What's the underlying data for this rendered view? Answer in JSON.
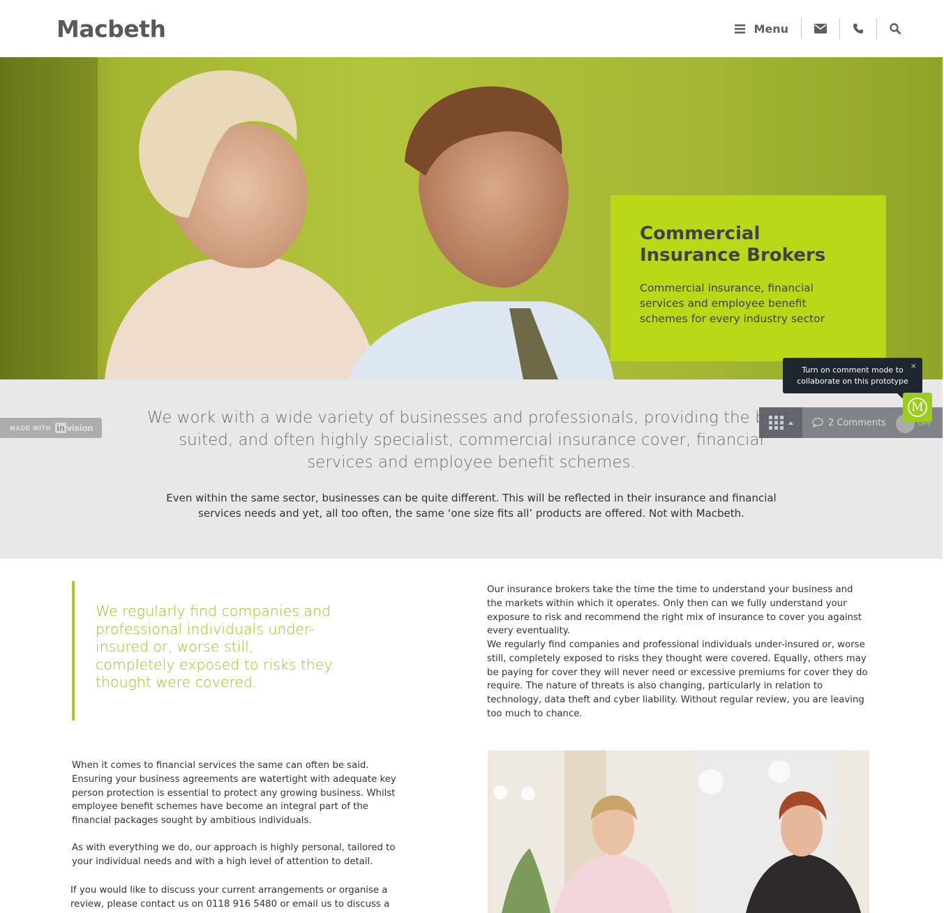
{
  "header": {
    "logo": "Macbeth",
    "menu_label": "Menu",
    "icons": [
      "bars-icon",
      "envelope-icon",
      "phone-icon",
      "search-icon"
    ]
  },
  "hero": {
    "title": "Commercial Insurance Brokers",
    "subtitle": "Commercial insurance, financial services and employee benefit schemes for every industry sector",
    "box_color": "#bad818"
  },
  "intro": {
    "lead": "We work with a wide variety of businesses and professionals, providing the best-suited, and often highly specialist, commercial insurance cover, financial services and employee benefit schemes.",
    "body": "Even within the same sector, businesses can be quite different. This will be reflected in their insurance and financial services needs and yet, all too often, the same ‘one size fits all’ products are offered. Not with Macbeth."
  },
  "invision": {
    "made_with": "MADE WITH",
    "brand_in": "in",
    "brand_vision": "vision",
    "comments": "2 Comments",
    "toggle": "OFF",
    "tooltip": "Turn on comment mode to collaborate on this prototype",
    "tooltip_close": "×",
    "badge_letter": "M"
  },
  "content": {
    "quote": "We regularly find companies and professional individuals under-insured or, worse still, completely exposed to risks they thought were covered.",
    "para1": "Our insurance brokers take the time the time to understand your business and the markets within which it operates. Only then can we fully understand your exposure to risk and recommend the right mix of insurance to cover you against every eventuality.",
    "para2": "We regularly find companies and professional individuals under-insured or, worse still, completely exposed to risks they thought were covered. Equally, others may be paying for cover they will never need or excessive premiums for cover they do require. The nature of threats is also changing, particularly in relation to technology, data theft and cyber liability. Without regular review, you are leaving too much to chance.",
    "para3": "When it comes to financial services the same can often be said. Ensuring your business agreements are watertight with adequate key person protection is essential to protect any growing business. Whilst employee benefit schemes have become an integral part of the financial packages sought by ambitious individuals.",
    "para4": "As with everything we do, our approach is highly personal, tailored to your individual needs and with a high level of attention to detail.",
    "para5": "If you would like to discuss your current arrangements or organise a review, please contact us on 0118 916 5480 or email us to discuss a specific issue."
  },
  "colors": {
    "accent": "#aacb1c",
    "hero_green": "#a6b737",
    "intro_bg": "#e8e8e9",
    "text_dark": "#2f3335"
  }
}
